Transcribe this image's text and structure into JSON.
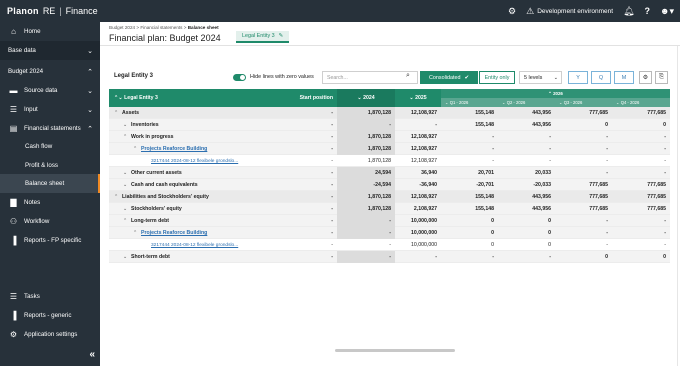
{
  "app": {
    "logo": "Planon",
    "product": "RE",
    "module": "Finance"
  },
  "topbar": {
    "environment": "Development environment"
  },
  "sidebar": {
    "items": [
      {
        "label": "Home",
        "icon": "home-icon"
      },
      {
        "label": "Base data"
      },
      {
        "label": "Budget 2024"
      },
      {
        "label": "Source data",
        "icon": "folder-icon"
      },
      {
        "label": "Input",
        "icon": "database-icon"
      },
      {
        "label": "Financial statements",
        "icon": "statements-icon"
      },
      {
        "label": "Cash flow"
      },
      {
        "label": "Profit & loss"
      },
      {
        "label": "Balance sheet"
      },
      {
        "label": "Notes",
        "icon": "notes-icon"
      },
      {
        "label": "Workflow",
        "icon": "users-icon"
      },
      {
        "label": "Reports - FP specific",
        "icon": "report-icon"
      },
      {
        "label": "Tasks",
        "icon": "tasks-icon"
      },
      {
        "label": "Reports - generic",
        "icon": "report-icon"
      },
      {
        "label": "Application settings",
        "icon": "gear-icon"
      }
    ]
  },
  "breadcrumb": {
    "part1": "Budget 2024",
    "sep": " > ",
    "part2": "Financial statements",
    "part3": "Balance sheet"
  },
  "page": {
    "title": "Financial plan: Budget 2024",
    "tab_label": "Legal Entity 3"
  },
  "toolbar": {
    "entity_title": "Legal Entity 3",
    "hide_zero_label": "Hide lines with zero values",
    "search_placeholder": "Search...",
    "consolidated_label": "Consolidated",
    "entity_only_label": "Entity only",
    "levels_value": "5 levels",
    "y_label": "Y",
    "q_label": "Q",
    "m_label": "M"
  },
  "grid": {
    "headers": {
      "entity": "Legal Entity 3",
      "start": "Start position",
      "y2024": "2024",
      "y2025": "2025",
      "y2026": "2026",
      "q1": "Q1 - 2026",
      "q2": "Q2 - 2026",
      "q3": "Q3 - 2026",
      "q4": "Q4 - 2026"
    },
    "rows": [
      {
        "label": "Assets",
        "start": "-",
        "y2024": "1,870,128",
        "y2025": "12,108,927",
        "q1": "155,148",
        "q2": "443,956",
        "q3": "777,685",
        "q4": "777,685"
      },
      {
        "label": "Inventories",
        "start": "-",
        "y2024": "-",
        "y2025": "-",
        "q1": "155,148",
        "q2": "443,956",
        "q3": "0",
        "q4": "0"
      },
      {
        "label": "Work in progress",
        "start": "-",
        "y2024": "1,870,128",
        "y2025": "12,108,927",
        "q1": "-",
        "q2": "-",
        "q3": "-",
        "q4": "-"
      },
      {
        "label": "Projects Reaforce Building",
        "start": "-",
        "y2024": "1,870,128",
        "y2025": "12,108,927",
        "q1": "-",
        "q2": "-",
        "q3": "-",
        "q4": "-"
      },
      {
        "label": "3217444 2024-08-12 flexibele grondslo...",
        "start": "-",
        "y2024": "1,870,128",
        "y2025": "12,108,927",
        "q1": "-",
        "q2": "-",
        "q3": "-",
        "q4": "-"
      },
      {
        "label": "Other current assets",
        "start": "-",
        "y2024": "24,594",
        "y2025": "36,940",
        "q1": "20,701",
        "q2": "20,033",
        "q3": "-",
        "q4": "-"
      },
      {
        "label": "Cash and cash equivalents",
        "start": "-",
        "y2024": "-24,594",
        "y2025": "-36,940",
        "q1": "-20,701",
        "q2": "-20,033",
        "q3": "777,685",
        "q4": "777,685"
      },
      {
        "label": "Liabilities and Stockholders' equity",
        "start": "-",
        "y2024": "1,870,128",
        "y2025": "12,108,927",
        "q1": "155,148",
        "q2": "443,956",
        "q3": "777,685",
        "q4": "777,685"
      },
      {
        "label": "Stockholders' equity",
        "start": "-",
        "y2024": "1,870,128",
        "y2025": "2,108,927",
        "q1": "155,148",
        "q2": "443,956",
        "q3": "777,685",
        "q4": "777,685"
      },
      {
        "label": "Long-term debt",
        "start": "-",
        "y2024": "-",
        "y2025": "10,000,000",
        "q1": "0",
        "q2": "0",
        "q3": "-",
        "q4": "-"
      },
      {
        "label": "Projects Reaforce Building",
        "start": "-",
        "y2024": "-",
        "y2025": "10,000,000",
        "q1": "0",
        "q2": "0",
        "q3": "-",
        "q4": "-"
      },
      {
        "label": "3217444 2024-08-12 flexibele grondslo...",
        "start": "-",
        "y2024": "-",
        "y2025": "10,000,000",
        "q1": "0",
        "q2": "0",
        "q3": "-",
        "q4": "-"
      },
      {
        "label": "Short-term debt",
        "start": "-",
        "y2024": "-",
        "y2025": "-",
        "q1": "-",
        "q2": "-",
        "q3": "0",
        "q4": "0"
      }
    ]
  }
}
